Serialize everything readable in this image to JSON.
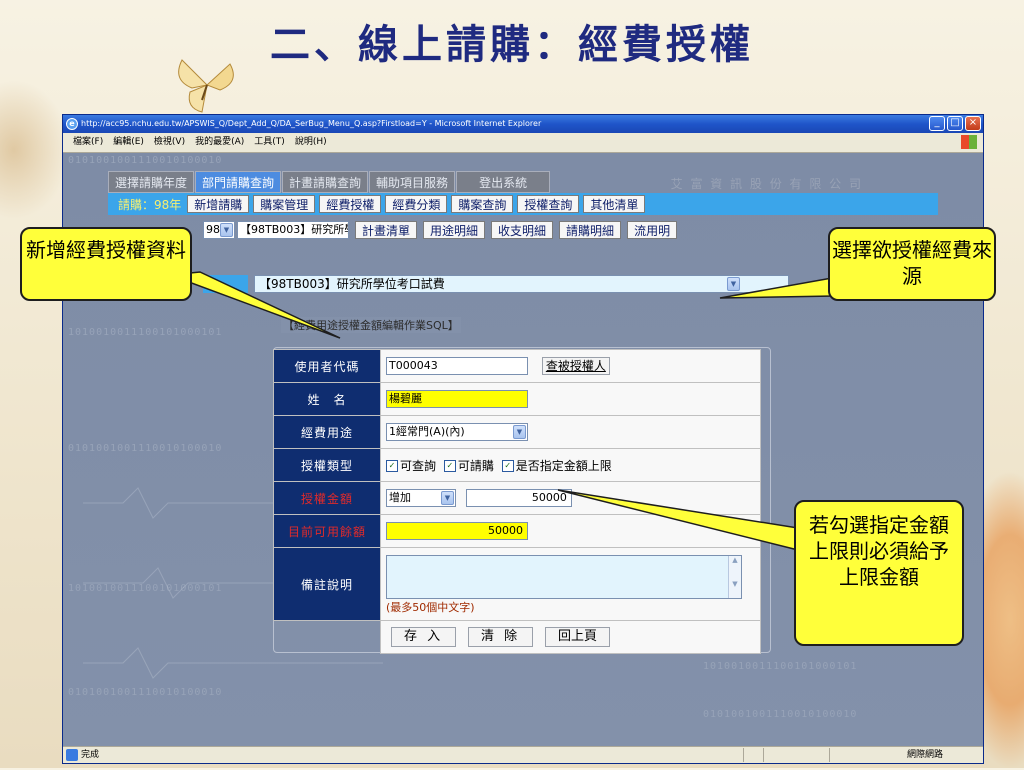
{
  "slide": {
    "title": "二、線上請購：經費授權"
  },
  "window": {
    "title": "http://acc95.nchu.edu.tw/APSWIS_Q/Dept_Add_Q/DA_SerBug_Menu_Q.asp?Firstload=Y - Microsoft Internet Explorer",
    "menu": [
      "檔案(F)",
      "編輯(E)",
      "檢視(V)",
      "我的最愛(A)",
      "工具(T)",
      "說明(H)"
    ],
    "status": "完成",
    "zone": "網際網路"
  },
  "nav": {
    "top_tabs": [
      {
        "label": "選擇請購年度",
        "active": false
      },
      {
        "label": "部門請購查詢",
        "active": true
      },
      {
        "label": "計畫請購查詢",
        "active": false
      },
      {
        "label": "輔助項目服務",
        "active": false
      },
      {
        "label": "登出系統",
        "active": false
      }
    ],
    "company": "艾 富 資 訊 股 份 有 限 公 司",
    "year_label": "請購：98年",
    "sub_tabs": [
      "新增請購",
      "購案管理",
      "經費授權",
      "經費分類",
      "購案查詢",
      "授權查詢",
      "其他清單"
    ],
    "year_select": "98",
    "project_select": "【98TB003】研究所學位考口試費",
    "detail_tabs": [
      "計畫清單",
      "用途明細",
      "收支明細",
      "請購明細",
      "流用明"
    ]
  },
  "source": {
    "selected": "【98TB003】研究所學位考口試費"
  },
  "form": {
    "title": "【經費用途授權金額編輯作業SQL】",
    "labels": {
      "user_code": "使用者代碼",
      "name": "姓　名",
      "usage": "經費用途",
      "auth_type": "授權類型",
      "auth_amount": "授權金額",
      "available": "目前可用餘額",
      "remarks": "備註說明"
    },
    "user_code": "T000043",
    "query_button": "查被授權人",
    "name": "楊碧麗",
    "usage": "1經常門(A)(內)",
    "checkboxes": [
      {
        "label": "可查詢",
        "checked": true
      },
      {
        "label": "可請購",
        "checked": true
      },
      {
        "label": "是否指定金額上限",
        "checked": true
      }
    ],
    "amount_op": "增加",
    "amount": "50000",
    "available": "50000",
    "remarks_value": "",
    "remarks_hint": "(最多50個中文字)",
    "buttons": {
      "save": "存 入",
      "clear": "清 除",
      "back": "回上頁"
    }
  },
  "callouts": {
    "left": "新增經費授權資料",
    "right_top": "選擇欲授權經費來源",
    "right_bottom": "若勾選指定金額上限則必須給予上限金額"
  },
  "background": {
    "binary_strings": [
      "0101001001110010100010",
      "1010010011100101000101",
      "0101001001110010100010",
      "1010010011100101000101",
      "0101001001110010100010",
      "1010010011100101000101",
      "0101001001110010100010"
    ]
  }
}
